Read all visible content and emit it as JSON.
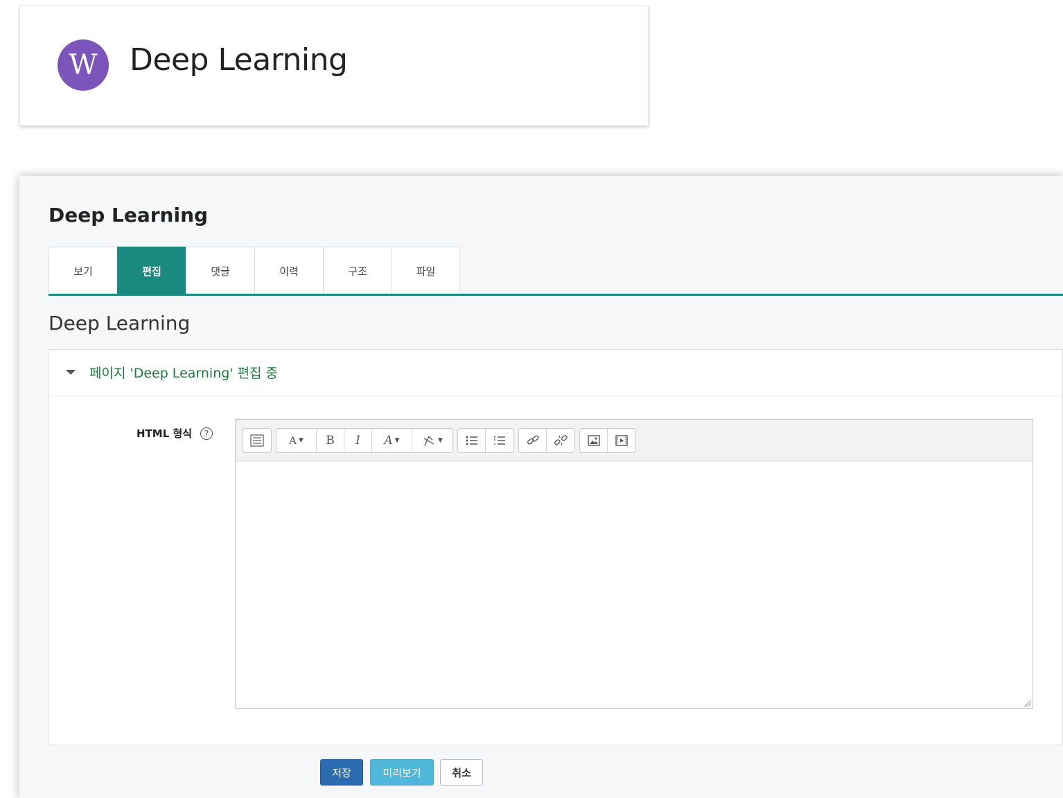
{
  "wiki_card": {
    "logo_letter": "W",
    "title": "Deep Learning",
    "logo_color": "#7b55b9"
  },
  "panel": {
    "title": "Deep Learning",
    "tabs": [
      {
        "label": "보기",
        "active": false
      },
      {
        "label": "편집",
        "active": true
      },
      {
        "label": "댓글",
        "active": false
      },
      {
        "label": "이력",
        "active": false
      },
      {
        "label": "구조",
        "active": false
      },
      {
        "label": "파일",
        "active": false
      }
    ],
    "page_heading": "Deep Learning",
    "accent_color": "#1a8a80"
  },
  "form": {
    "header": "페이지 'Deep Learning' 편집 중",
    "field_label": "HTML 형식",
    "help_glyph": "?",
    "editor_value": "",
    "toolbar": {
      "bold": "B",
      "italic": "I",
      "font_style": "A",
      "font_color": "A",
      "dropdown_glyph": "▼"
    }
  },
  "buttons": {
    "save": "저장",
    "preview": "미리보기",
    "cancel": "취소"
  }
}
